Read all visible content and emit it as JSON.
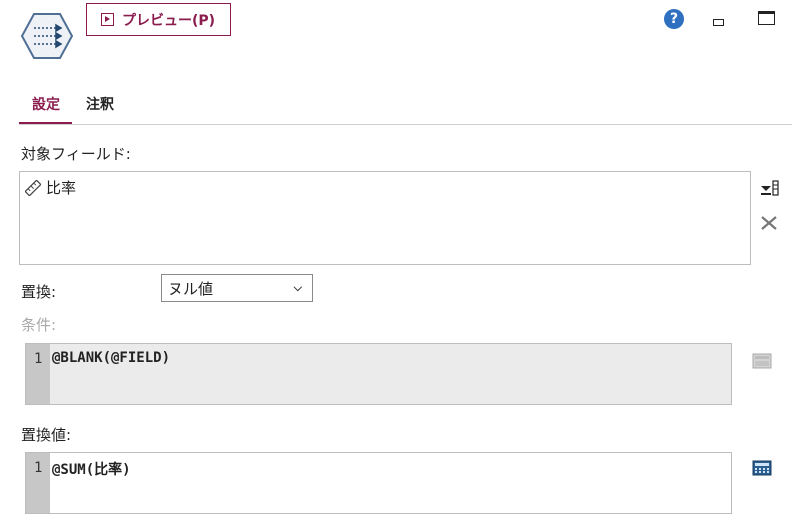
{
  "header": {
    "preview_label": "プレビュー(P)",
    "help_icon": "?"
  },
  "tabs": [
    {
      "label": "設定",
      "active": true
    },
    {
      "label": "注釈",
      "active": false
    }
  ],
  "fields": {
    "label": "対象フィールド:",
    "items": [
      {
        "icon": "ruler-icon",
        "name": "比率"
      }
    ]
  },
  "replace": {
    "label": "置換:",
    "selected": "ヌル値"
  },
  "condition": {
    "label": "条件:",
    "line_number": "1",
    "code": "@BLANK(@FIELD)"
  },
  "replacement": {
    "label": "置換値:",
    "line_number": "1",
    "code": "@SUM(比率)"
  },
  "colors": {
    "accent": "#8a1c4e",
    "help": "#2f6fbf"
  }
}
